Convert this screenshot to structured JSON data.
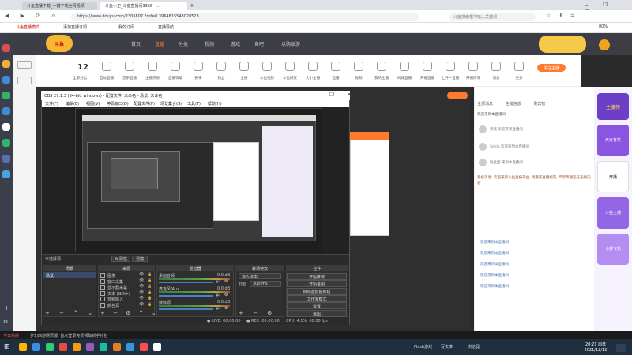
{
  "browser": {
    "tabs": [
      "斗鱼直播下载_一键下载全网视频",
      "斗鱼小卫_斗鱼直播间3366 - ..."
    ],
    "url": "https://www.douyu.com/2306807 ?rid=0.3964615548028523",
    "search_placeholder": "斗鱼搜索框中输入关键词",
    "bookmarks": [
      "斗鱼直播模式",
      "添加直播订阅",
      "我的订阅",
      "直播导航"
    ],
    "zoom": "80%"
  },
  "douyu": {
    "nav": [
      "首页",
      "直播",
      "分类",
      "视频",
      "游戏",
      "鱼吧",
      "以购联游"
    ],
    "side_count": "12",
    "side_label": "全部分类",
    "categories": [
      "互动直播",
      "音乐直播",
      "主播热榜",
      "直播等级",
      "赛事",
      "粉丝",
      "主播",
      "斗鱼视频",
      "斗鱼好友",
      "大小主播",
      "直播",
      "视频",
      "我的主播",
      "同城直播",
      "开播直播",
      "上升一直播",
      "开播情况",
      "消息",
      "更多"
    ],
    "follow_btn": "关注主播",
    "chat_tabs": [
      "全部消息",
      "主播信息",
      "贵宾榜"
    ],
    "chat_lines": [
      "欢迎来到本直播间",
      "贵宾 欢迎来到直播间",
      "Smile 欢迎来到本直播间",
      "粉丝团 来到本直播间",
      "系统消息: 欢迎来到斗鱼直播平台, 请遵守直播规范, 严禁传播违法违规内容",
      "欢迎来到本直播间",
      "欢迎来到本直播间",
      "欢迎来到本直播间",
      "欢迎来到本直播间",
      "欢迎来到本直播间"
    ],
    "right_banners": [
      "斗鱼主播",
      "主播榜",
      "天天有奖",
      "开播",
      "斗鱼主播",
      "小部飞机"
    ]
  },
  "obs": {
    "title": "OBS 27.1.3 (64-bit, windows) - 配置文件: 未命名 - 场景: 未命名",
    "menu": [
      "文件(F)",
      "编辑(E)",
      "视图(V)",
      "停靠窗口(D)",
      "配置文件(P)",
      "场景集合(S)",
      "工具(T)",
      "帮助(H)"
    ],
    "source_label": "未选择源",
    "props_btn": "属性",
    "filters_btn": "滤镜",
    "docks": {
      "scenes": "场景",
      "sources": "来源",
      "mixer": "混音器",
      "transitions": "转场特效",
      "controls": "控件"
    },
    "scene_items": [
      "场景"
    ],
    "source_items": [
      "图像",
      "窗口采集",
      "显示器采集",
      "文本 (GDI+)",
      "音频输入",
      "颜色源"
    ],
    "mixer_items": [
      {
        "name": "桌面音频",
        "db": "0.0 dB"
      },
      {
        "name": "麦克风/Aux",
        "db": "0.0 dB"
      },
      {
        "name": "媒体源",
        "db": "0.0 dB"
      }
    ],
    "transition_type": "淡入淡出",
    "duration_label": "时长",
    "duration_value": "300 ms",
    "controls": [
      "开始推流",
      "开始录制",
      "启动虚拟摄像机",
      "工作室模式",
      "设置",
      "退出"
    ],
    "status": {
      "live": "LIVE: 00:00:00",
      "rec": "REC: 00:00:00",
      "cpu": "CPU: 4.1%, 60.00 fps"
    }
  },
  "taskbar": {
    "notification": "今日热搜",
    "note": "梦幻西游网页版: 首次登录免费领取新手礼包",
    "apps": [
      "Flash游戏",
      "写文章",
      "浏览器"
    ],
    "time": "20:21 周日",
    "date": "2021/12/12"
  }
}
